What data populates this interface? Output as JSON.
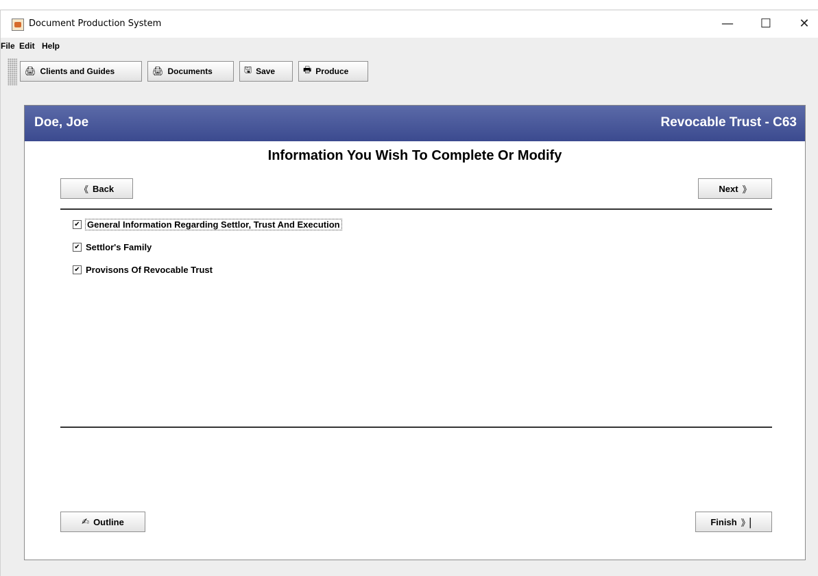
{
  "window": {
    "title": "Document Production System",
    "minimize_glyph": "—",
    "maximize_glyph": "☐",
    "close_glyph": "✕"
  },
  "menu": {
    "items": [
      "File",
      "Edit",
      "Help"
    ]
  },
  "toolbar": {
    "buttons": [
      {
        "label": "Clients and Guides",
        "icon": "printer-icon",
        "glyph": "🖨"
      },
      {
        "label": "Documents",
        "icon": "printer-icon",
        "glyph": "🖨"
      },
      {
        "label": "Save",
        "icon": "save-icon",
        "glyph": "🖫"
      },
      {
        "label": "Produce",
        "icon": "printer-icon",
        "glyph": "🖶"
      }
    ]
  },
  "header": {
    "client": "Doe, Joe",
    "document": "Revocable Trust - C63",
    "color": "#4a5a9c"
  },
  "main": {
    "title": "Information You Wish To Complete Or Modify",
    "back": {
      "label": "Back",
      "glyph": "《"
    },
    "next": {
      "label": "Next",
      "glyph": "》"
    },
    "outline": {
      "label": "Outline",
      "glyph": "✍"
    },
    "finish": {
      "label": "Finish",
      "glyph": "》▏"
    },
    "options": [
      {
        "label": "General Information Regarding Settlor, Trust And Execution",
        "checked": true
      },
      {
        "label": "Settlor's Family",
        "checked": true
      },
      {
        "label": "Provisons Of Revocable Trust",
        "checked": true
      }
    ],
    "check_glyph": "✔"
  }
}
